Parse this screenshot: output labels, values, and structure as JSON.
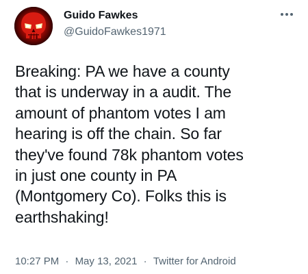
{
  "tweet": {
    "author": {
      "display_name": "Guido Fawkes",
      "handle": "@GuidoFawkes1971",
      "avatar_icon": "red-skull-avatar"
    },
    "more_icon": "more-options-icon",
    "text": "Breaking: PA we have a county\nthat is underway in a audit. The\namount of phantom votes I am\nhearing is off the chain. So far\nthey've found 78k phantom votes\nin just one county in PA\n(Montgomery Co). Folks this is\nearthshaking!",
    "time": "10:27 PM",
    "date": "May 13, 2021",
    "separator": "·",
    "source": "Twitter for Android"
  },
  "colors": {
    "text_primary": "#0f1419",
    "text_secondary": "#536471",
    "background": "#ffffff",
    "avatar_accent": "#e0201a"
  }
}
